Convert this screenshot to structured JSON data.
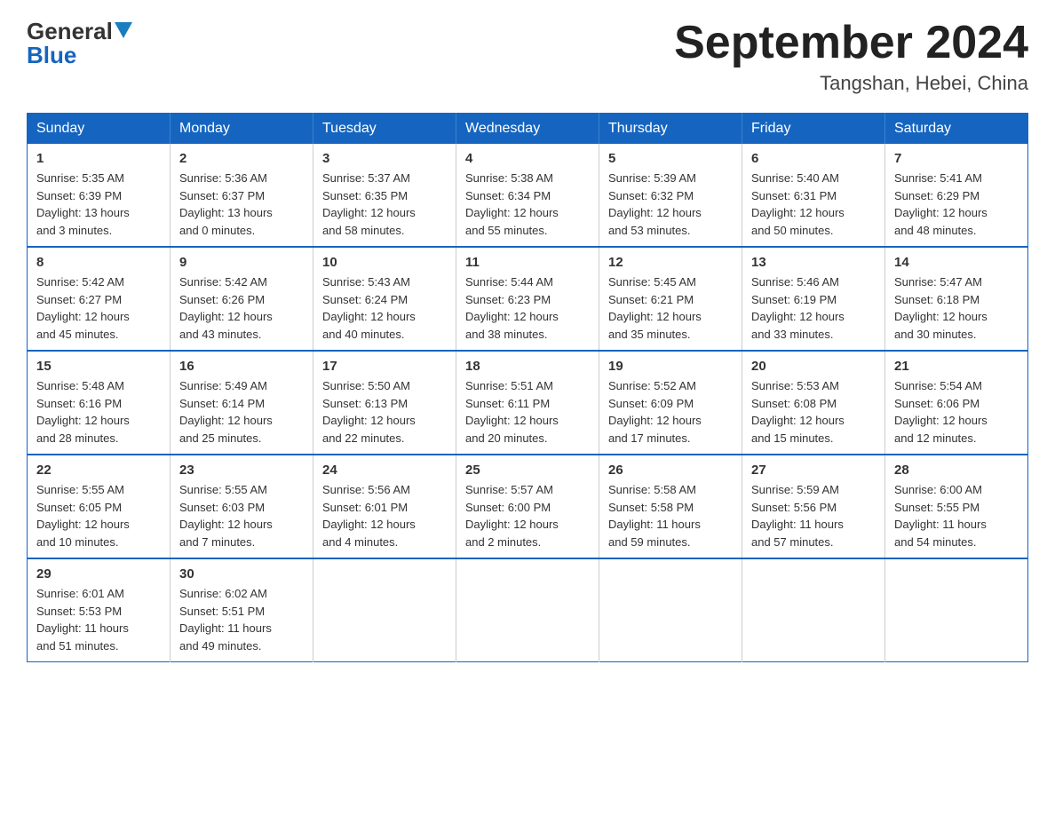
{
  "logo": {
    "general": "General",
    "blue": "Blue",
    "tagline": "Blue"
  },
  "title": "September 2024",
  "subtitle": "Tangshan, Hebei, China",
  "weekdays": [
    "Sunday",
    "Monday",
    "Tuesday",
    "Wednesday",
    "Thursday",
    "Friday",
    "Saturday"
  ],
  "weeks": [
    [
      {
        "day": "1",
        "info": "Sunrise: 5:35 AM\nSunset: 6:39 PM\nDaylight: 13 hours\nand 3 minutes."
      },
      {
        "day": "2",
        "info": "Sunrise: 5:36 AM\nSunset: 6:37 PM\nDaylight: 13 hours\nand 0 minutes."
      },
      {
        "day": "3",
        "info": "Sunrise: 5:37 AM\nSunset: 6:35 PM\nDaylight: 12 hours\nand 58 minutes."
      },
      {
        "day": "4",
        "info": "Sunrise: 5:38 AM\nSunset: 6:34 PM\nDaylight: 12 hours\nand 55 minutes."
      },
      {
        "day": "5",
        "info": "Sunrise: 5:39 AM\nSunset: 6:32 PM\nDaylight: 12 hours\nand 53 minutes."
      },
      {
        "day": "6",
        "info": "Sunrise: 5:40 AM\nSunset: 6:31 PM\nDaylight: 12 hours\nand 50 minutes."
      },
      {
        "day": "7",
        "info": "Sunrise: 5:41 AM\nSunset: 6:29 PM\nDaylight: 12 hours\nand 48 minutes."
      }
    ],
    [
      {
        "day": "8",
        "info": "Sunrise: 5:42 AM\nSunset: 6:27 PM\nDaylight: 12 hours\nand 45 minutes."
      },
      {
        "day": "9",
        "info": "Sunrise: 5:42 AM\nSunset: 6:26 PM\nDaylight: 12 hours\nand 43 minutes."
      },
      {
        "day": "10",
        "info": "Sunrise: 5:43 AM\nSunset: 6:24 PM\nDaylight: 12 hours\nand 40 minutes."
      },
      {
        "day": "11",
        "info": "Sunrise: 5:44 AM\nSunset: 6:23 PM\nDaylight: 12 hours\nand 38 minutes."
      },
      {
        "day": "12",
        "info": "Sunrise: 5:45 AM\nSunset: 6:21 PM\nDaylight: 12 hours\nand 35 minutes."
      },
      {
        "day": "13",
        "info": "Sunrise: 5:46 AM\nSunset: 6:19 PM\nDaylight: 12 hours\nand 33 minutes."
      },
      {
        "day": "14",
        "info": "Sunrise: 5:47 AM\nSunset: 6:18 PM\nDaylight: 12 hours\nand 30 minutes."
      }
    ],
    [
      {
        "day": "15",
        "info": "Sunrise: 5:48 AM\nSunset: 6:16 PM\nDaylight: 12 hours\nand 28 minutes."
      },
      {
        "day": "16",
        "info": "Sunrise: 5:49 AM\nSunset: 6:14 PM\nDaylight: 12 hours\nand 25 minutes."
      },
      {
        "day": "17",
        "info": "Sunrise: 5:50 AM\nSunset: 6:13 PM\nDaylight: 12 hours\nand 22 minutes."
      },
      {
        "day": "18",
        "info": "Sunrise: 5:51 AM\nSunset: 6:11 PM\nDaylight: 12 hours\nand 20 minutes."
      },
      {
        "day": "19",
        "info": "Sunrise: 5:52 AM\nSunset: 6:09 PM\nDaylight: 12 hours\nand 17 minutes."
      },
      {
        "day": "20",
        "info": "Sunrise: 5:53 AM\nSunset: 6:08 PM\nDaylight: 12 hours\nand 15 minutes."
      },
      {
        "day": "21",
        "info": "Sunrise: 5:54 AM\nSunset: 6:06 PM\nDaylight: 12 hours\nand 12 minutes."
      }
    ],
    [
      {
        "day": "22",
        "info": "Sunrise: 5:55 AM\nSunset: 6:05 PM\nDaylight: 12 hours\nand 10 minutes."
      },
      {
        "day": "23",
        "info": "Sunrise: 5:55 AM\nSunset: 6:03 PM\nDaylight: 12 hours\nand 7 minutes."
      },
      {
        "day": "24",
        "info": "Sunrise: 5:56 AM\nSunset: 6:01 PM\nDaylight: 12 hours\nand 4 minutes."
      },
      {
        "day": "25",
        "info": "Sunrise: 5:57 AM\nSunset: 6:00 PM\nDaylight: 12 hours\nand 2 minutes."
      },
      {
        "day": "26",
        "info": "Sunrise: 5:58 AM\nSunset: 5:58 PM\nDaylight: 11 hours\nand 59 minutes."
      },
      {
        "day": "27",
        "info": "Sunrise: 5:59 AM\nSunset: 5:56 PM\nDaylight: 11 hours\nand 57 minutes."
      },
      {
        "day": "28",
        "info": "Sunrise: 6:00 AM\nSunset: 5:55 PM\nDaylight: 11 hours\nand 54 minutes."
      }
    ],
    [
      {
        "day": "29",
        "info": "Sunrise: 6:01 AM\nSunset: 5:53 PM\nDaylight: 11 hours\nand 51 minutes."
      },
      {
        "day": "30",
        "info": "Sunrise: 6:02 AM\nSunset: 5:51 PM\nDaylight: 11 hours\nand 49 minutes."
      },
      {
        "day": "",
        "info": ""
      },
      {
        "day": "",
        "info": ""
      },
      {
        "day": "",
        "info": ""
      },
      {
        "day": "",
        "info": ""
      },
      {
        "day": "",
        "info": ""
      }
    ]
  ]
}
